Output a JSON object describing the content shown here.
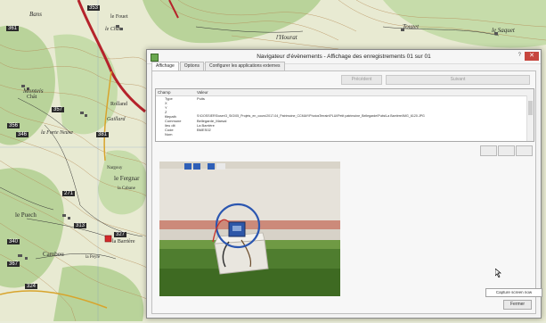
{
  "map": {
    "labels": {
      "bans": "Bans",
      "fouet": "le Fouet",
      "chat": "le Chat",
      "hourat": "l'Hourat",
      "touzet": "Touzet",
      "saquet": "le Saquet",
      "monteis": "Monteis",
      "chat2": "Chât",
      "rolland": "Rolland",
      "gaillard": "Gaillard",
      "forte_neuve": "la Forte Neuve",
      "nargouy": "Nargouy",
      "le_fergnar": "le Fergnar",
      "la_cabane": "la Cabane",
      "le_puech": "le Puech",
      "la_bamiere": "la Barrière",
      "cambou": "Cambou",
      "la_peyre": "la Peyre",
      "n_361": "361",
      "n_353": "353",
      "n_356": "356",
      "n_381": "381",
      "n_346": "346",
      "n_357": "357",
      "n_271": "271",
      "n_313": "313",
      "n_340": "340",
      "n_367": "367",
      "n_324": "324",
      "n_327": "327"
    }
  },
  "dialog": {
    "title": "Navigateur d'évènements - Affichage des enregistrements 01 sur 01",
    "help": "?",
    "close": "✕",
    "tabs": {
      "t0": "Affichage",
      "t1": "Options",
      "t2": "Configurer les applications externes"
    },
    "buttons": {
      "previous": "Précédent",
      "next": "Suivant",
      "close": "Fermer"
    },
    "attr": {
      "col_field": "Champ",
      "col_value": "Valeur",
      "rows": [
        {
          "k": "Type",
          "v": "Puits"
        },
        {
          "k": "X",
          "v": ""
        },
        {
          "k": "Y",
          "v": ""
        },
        {
          "k": "Z",
          "v": ""
        },
        {
          "k": "filepath",
          "v": "S:\\DOSSIERS\\user\\3_SIG\\05_Projets_en_cours\\2017-04_Patrimoine_CCMAY\\PhotosTerrain\\PLUi\\Petit patrimoine_Bellegarde\\Puits\\La Barrière\\IMG_6120.JPG"
        },
        {
          "k": "Commune",
          "v": "Bellegarde_Marsal"
        },
        {
          "k": "lieu dit",
          "v": "La Barrière"
        },
        {
          "k": "Code",
          "v": "BMES02"
        },
        {
          "k": "Nom",
          "v": ""
        }
      ]
    },
    "tooltip": "Capture screen now"
  },
  "colors": {
    "road": "#b5232b",
    "close": "#c7463e",
    "wall": "#e6e2da",
    "shutter": "#2f5fb7",
    "grass": "#4f7d2f"
  }
}
